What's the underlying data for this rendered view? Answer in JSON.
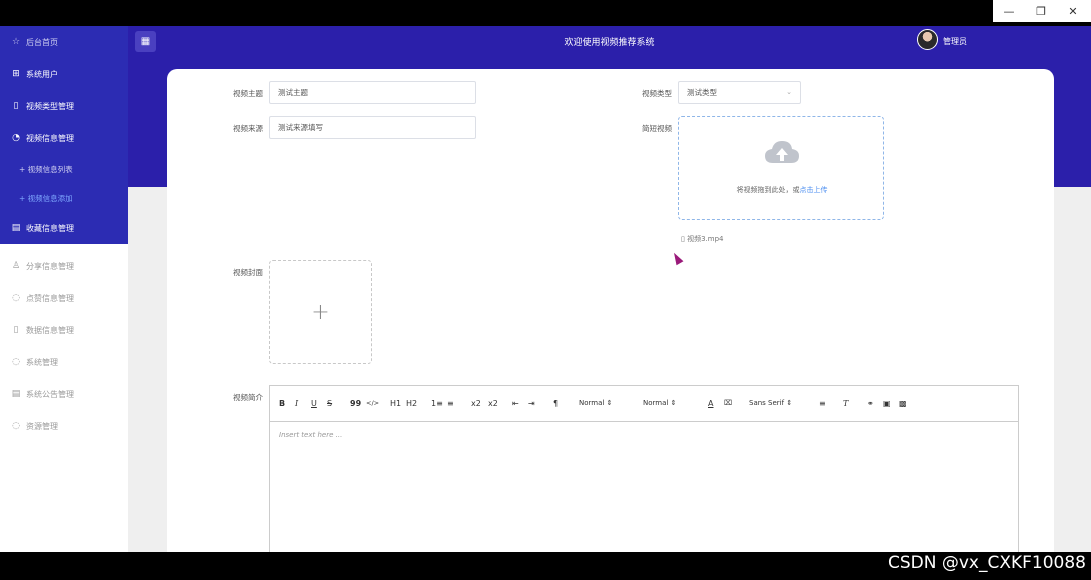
{
  "window_controls": {
    "minimize": "—",
    "restore": "❐",
    "close": "✕"
  },
  "sidebar": {
    "items": [
      {
        "label": "后台首页",
        "icon": "star-icon"
      },
      {
        "label": "系统用户",
        "icon": "grid-icon"
      },
      {
        "label": "视频类型管理",
        "icon": "document-icon"
      },
      {
        "label": "视频信息管理",
        "icon": "gauge-icon"
      },
      {
        "label": "+ 视频信息列表"
      },
      {
        "label": "+ 视频信息添加"
      },
      {
        "label": "收藏信息管理",
        "icon": "calendar-icon"
      },
      {
        "label": "分享信息管理",
        "icon": "user-icon"
      },
      {
        "label": "点赞信息管理",
        "icon": "chat-icon"
      },
      {
        "label": "数据信息管理",
        "icon": "document-icon"
      },
      {
        "label": "系统管理",
        "icon": "chat-icon"
      },
      {
        "label": "系统公告管理",
        "icon": "calendar-icon"
      },
      {
        "label": "资源管理",
        "icon": "chat-icon"
      }
    ]
  },
  "header": {
    "title": "欢迎使用视频推荐系统",
    "user": "管理员"
  },
  "form": {
    "topic_label": "视频主题",
    "topic_value": "测试主题",
    "source_label": "视频来源",
    "source_value": "测试来源填写",
    "type_label": "视频类型",
    "type_value": "测试类型",
    "upload_label": "简短视频",
    "upload_hint": "将视频拖到此处，或",
    "upload_link": "点击上传",
    "uploaded_file": "视频3.mp4",
    "cover_label": "视频封面",
    "cover_plus": "+",
    "intro_label": "视频简介",
    "editor_placeholder": "Insert text here ..."
  },
  "editor_toolbar": {
    "bold": "B",
    "italic": "I",
    "underline": "U",
    "strike": "S",
    "quote": "99",
    "code": "</>",
    "h1": "H1",
    "h2": "H2",
    "ordered": "1≡",
    "bullet": "≡",
    "sub": "x2",
    "sup": "x2",
    "outdent": "⇤",
    "indent": "⇥",
    "direction": "¶",
    "size1": "Normal",
    "size2": "Normal",
    "font": "Sans Serif"
  },
  "watermark": "CSDN @vx_CXKF10088",
  "colors": {
    "sidebar_top": "#2c2cb3",
    "header": "#2b1faa",
    "link": "#4b8ef0"
  }
}
